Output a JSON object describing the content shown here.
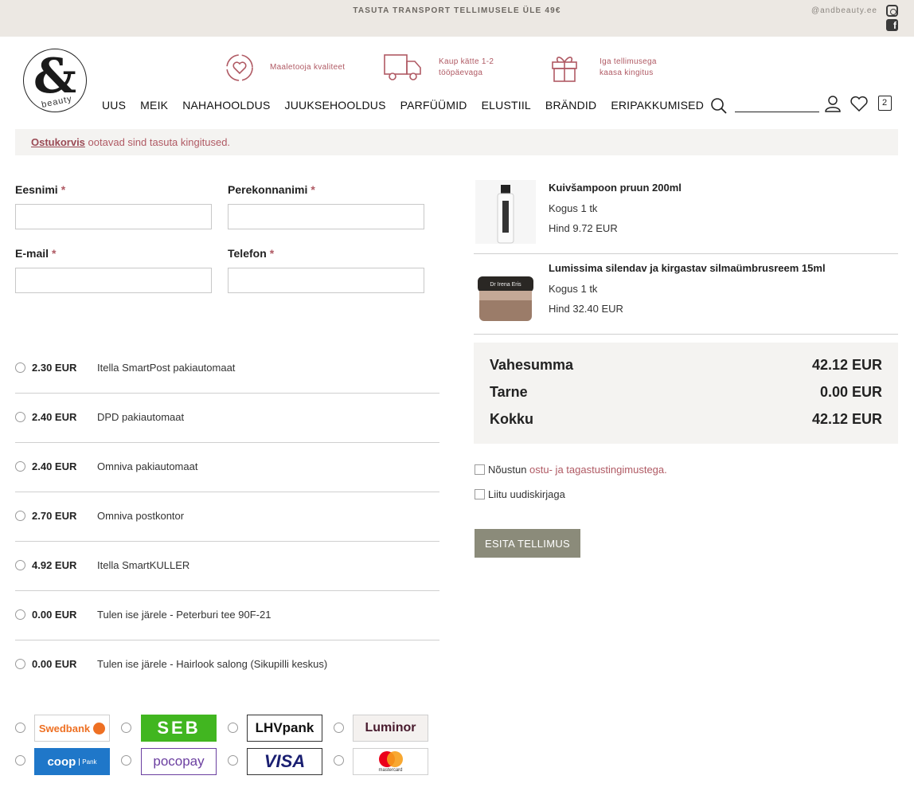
{
  "topbar": {
    "promo": "TASUTA TRANSPORT TELLIMUSELE ÜLE 49€",
    "handle": "@andbeauty.ee"
  },
  "brand": {
    "logo_symbol": "&",
    "logo_word": "beauty"
  },
  "features": [
    {
      "icon": "heart-circle-icon",
      "line1": "Maaletooja kvaliteet",
      "line2": ""
    },
    {
      "icon": "truck-icon",
      "line1": "Kaup kätte 1-2",
      "line2": "tööpäevaga"
    },
    {
      "icon": "gift-icon",
      "line1": "Iga tellimusega",
      "line2": "kaasa kingitus"
    }
  ],
  "nav": [
    "UUS",
    "MEIK",
    "NAHAHOOLDUS",
    "JUUKSEHOOLDUS",
    "PARFÜÜMID",
    "ELUSTIIL",
    "BRÄNDID",
    "ERIPAKKUMISED"
  ],
  "header_icons": {
    "cart_count": "2"
  },
  "notice": {
    "link": "Ostukorvis",
    "text": " ootavad sind tasuta kingitused."
  },
  "form": {
    "first_name": {
      "label": "Eesnimi",
      "value": ""
    },
    "last_name": {
      "label": "Perekonnanimi",
      "value": ""
    },
    "email": {
      "label": "E-mail",
      "value": ""
    },
    "phone": {
      "label": "Telefon",
      "value": ""
    },
    "required_mark": "*"
  },
  "shipping": [
    {
      "price": "2.30 EUR",
      "name": "Itella SmartPost pakiautomaat"
    },
    {
      "price": "2.40 EUR",
      "name": "DPD pakiautomaat"
    },
    {
      "price": "2.40 EUR",
      "name": "Omniva pakiautomaat"
    },
    {
      "price": "2.70 EUR",
      "name": "Omniva postkontor"
    },
    {
      "price": "4.92 EUR",
      "name": "Itella SmartKULLER"
    },
    {
      "price": "0.00 EUR",
      "name": "Tulen ise järele - Peterburi tee 90F-21"
    },
    {
      "price": "0.00 EUR",
      "name": "Tulen ise järele - Hairlook salong (Sikupilli keskus)"
    }
  ],
  "payments": [
    {
      "name": "Swedbank",
      "color": "#ee7023"
    },
    {
      "name": "SEB",
      "color": "#41b620"
    },
    {
      "name": "LHVpank",
      "color": "#111111"
    },
    {
      "name": "Luminor",
      "color": "#481a2d"
    },
    {
      "name": "coop",
      "sub": "Pank",
      "color": "#1f77c9"
    },
    {
      "name": "pocopay",
      "color": "#6b3fa0"
    },
    {
      "name": "VISA",
      "color": "#1a1f71"
    },
    {
      "name": "mastercard",
      "color": "#eb001b"
    }
  ],
  "cart": {
    "items": [
      {
        "title": "Kuivšampoon pruun 200ml",
        "qty": "Kogus 1 tk",
        "price": "Hind 9.72 EUR",
        "image": "shampoo-bottle"
      },
      {
        "title": "Lumissima silendav ja kirgastav silmaümbrusreem 15ml",
        "qty": "Kogus 1 tk",
        "price": "Hind 32.40 EUR",
        "image": "cream-jar",
        "jar_label": "Dr Irena Eris"
      }
    ],
    "totals": [
      {
        "label": "Vahesumma",
        "value": "42.12 EUR"
      },
      {
        "label": "Tarne",
        "value": "0.00 EUR"
      },
      {
        "label": "Kokku",
        "value": "42.12 EUR"
      }
    ]
  },
  "agreements": {
    "terms_prefix": "Nõustun ",
    "terms_link": "ostu- ja tagastustingimustega",
    "terms_suffix": ".",
    "newsletter": "Liitu uudiskirjaga"
  },
  "submit_label": "ESITA TELLIMUS"
}
